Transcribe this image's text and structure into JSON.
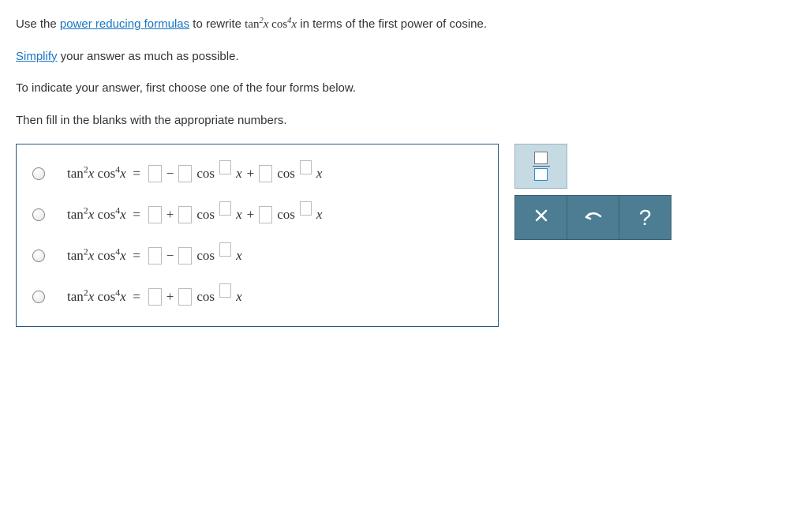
{
  "instructions": {
    "line1_a": "Use the ",
    "link1": "power reducing formulas",
    "line1_b": " to rewrite ",
    "expr_prompt": "tan²x cos⁴x",
    "line1_c": " in terms of the first power of cosine.",
    "line2_link": "Simplify",
    "line2_rest": " your answer as much as possible.",
    "line3": "To indicate your answer, first choose one of the four forms below.",
    "line4": "Then fill in the blanks with the appropriate numbers."
  },
  "lhs": {
    "tan": "tan",
    "exp1": "2",
    "var": "x",
    "cos": "cos",
    "exp2": "4",
    "eq": "="
  },
  "ops": {
    "plus": "+",
    "minus": "−"
  },
  "cos_label": "cos",
  "var_x": "x",
  "toolbar": {
    "help": "?"
  }
}
